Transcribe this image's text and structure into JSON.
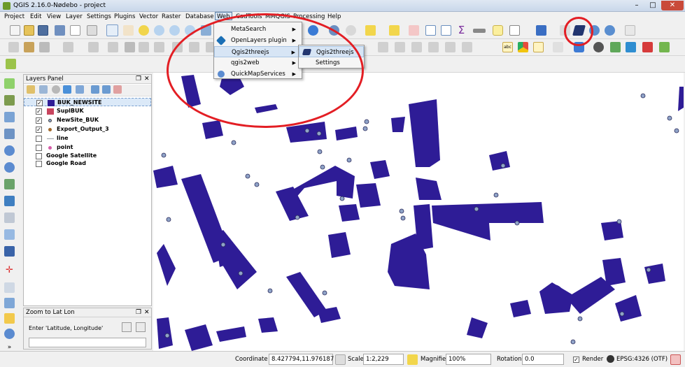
{
  "window": {
    "title": "QGIS 2.16.0-Nødebo - project",
    "min": "–",
    "max": "□",
    "close": "✕"
  },
  "menubar": [
    "Project",
    "Edit",
    "View",
    "Layer",
    "Settings",
    "Plugins",
    "Vector",
    "Raster",
    "Database",
    "Web",
    "CadTools",
    "MMQGIS",
    "Processing",
    "Help"
  ],
  "web_menu": {
    "items": [
      {
        "label": "MetaSearch",
        "arrow": "▶"
      },
      {
        "label": "OpenLayers plugin",
        "arrow": "▶"
      },
      {
        "label": "Qgis2threejs",
        "arrow": "▶"
      },
      {
        "label": "qgis2web",
        "arrow": "▶"
      },
      {
        "label": "QuickMapServices",
        "arrow": "▶"
      }
    ]
  },
  "qgis2threejs_submenu": {
    "items": [
      "Qgis2threejs",
      "Settings"
    ]
  },
  "layers_panel": {
    "title": "Layers Panel",
    "layers": [
      {
        "name": "BUK_NEWSITE",
        "checked": "✓",
        "symbol": "fill-dark"
      },
      {
        "name": "SuplBUK",
        "checked": "✓",
        "symbol": "fill-red"
      },
      {
        "name": "NewSite_BUK",
        "checked": "✓",
        "symbol": "point-blue"
      },
      {
        "name": "Export_Output_3",
        "checked": "✓",
        "symbol": "point-brown"
      },
      {
        "name": "line",
        "checked": "",
        "symbol": "line"
      },
      {
        "name": "point",
        "checked": "",
        "symbol": "point-pink"
      },
      {
        "name": "Google Satellite",
        "checked": "",
        "symbol": "none"
      },
      {
        "name": "Google Road",
        "checked": "",
        "symbol": "none"
      }
    ]
  },
  "zoom_panel": {
    "title": "Zoom to Lat Lon",
    "prompt": "Enter 'Latitude, Longitude'"
  },
  "statusbar": {
    "coordinate_label": "Coordinate",
    "coordinate": "8.427794,11.976187",
    "scale_label": "Scale",
    "scale": "1:2,229",
    "magnifier_label": "Magnifier",
    "magnifier": "100%",
    "rotation_label": "Rotation",
    "rotation": "0.0",
    "render_label": "Render",
    "render_checked": "✓",
    "crs": "EPSG:4326 (OTF)"
  },
  "colors": {
    "building": "#2e1c96",
    "point_fill": "#8fa3c7",
    "annotation": "#e31e24",
    "highlight": "#d7e5f5"
  }
}
